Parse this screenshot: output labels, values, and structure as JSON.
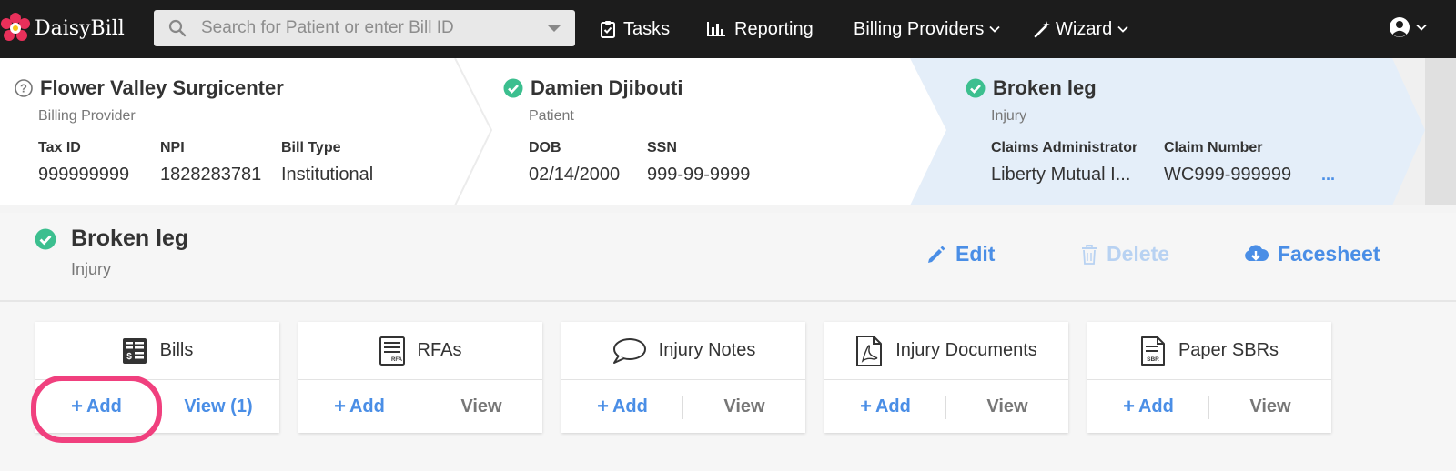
{
  "nav": {
    "logo_text": "DaisyBill",
    "search_placeholder": "Search for Patient or enter Bill ID",
    "items": [
      {
        "label": "Tasks",
        "icon": "clipboard-check-icon"
      },
      {
        "label": "Reporting",
        "icon": "bar-chart-icon"
      },
      {
        "label": "Billing Providers",
        "icon": "chevron-down-icon"
      },
      {
        "label": "Wizard",
        "icon": "magic-wand-icon"
      }
    ],
    "user_icon": "user-circle-icon"
  },
  "context": {
    "provider": {
      "title": "Flower Valley Surgicenter",
      "subtitle": "Billing Provider",
      "fields": [
        {
          "label": "Tax ID",
          "value": "999999999"
        },
        {
          "label": "NPI",
          "value": "1828283781"
        },
        {
          "label": "Bill Type",
          "value": "Institutional"
        }
      ]
    },
    "patient": {
      "title": "Damien Djibouti",
      "subtitle": "Patient",
      "fields": [
        {
          "label": "DOB",
          "value": "02/14/2000"
        },
        {
          "label": "SSN",
          "value": "999-99-9999"
        }
      ]
    },
    "injury": {
      "title": "Broken leg",
      "subtitle": "Injury",
      "fields": [
        {
          "label": "Claims Administrator",
          "value": "Liberty Mutual I..."
        },
        {
          "label": "Claim Number",
          "value": "WC999-999999"
        }
      ],
      "more": "..."
    }
  },
  "panel": {
    "title": "Broken leg",
    "subtitle": "Injury",
    "actions": {
      "edit": "Edit",
      "delete": "Delete",
      "facesheet": "Facesheet"
    }
  },
  "cards": [
    {
      "title": "Bills",
      "icon": "bill-list-icon",
      "add": "Add",
      "view": "View (1)"
    },
    {
      "title": "RFAs",
      "icon": "rfa-document-icon",
      "add": "Add",
      "view": "View"
    },
    {
      "title": "Injury Notes",
      "icon": "speech-bubble-icon",
      "add": "Add",
      "view": "View"
    },
    {
      "title": "Injury Documents",
      "icon": "pdf-file-icon",
      "add": "Add",
      "view": "View"
    },
    {
      "title": "Paper SBRs",
      "icon": "sbr-document-icon",
      "add": "Add",
      "view": "View"
    }
  ],
  "colors": {
    "nav_bg": "#1c1c1c",
    "accent": "#4a8ee6",
    "success": "#3cbf8f",
    "highlight": "#f0407e",
    "disabled": "#b8d2f2"
  }
}
